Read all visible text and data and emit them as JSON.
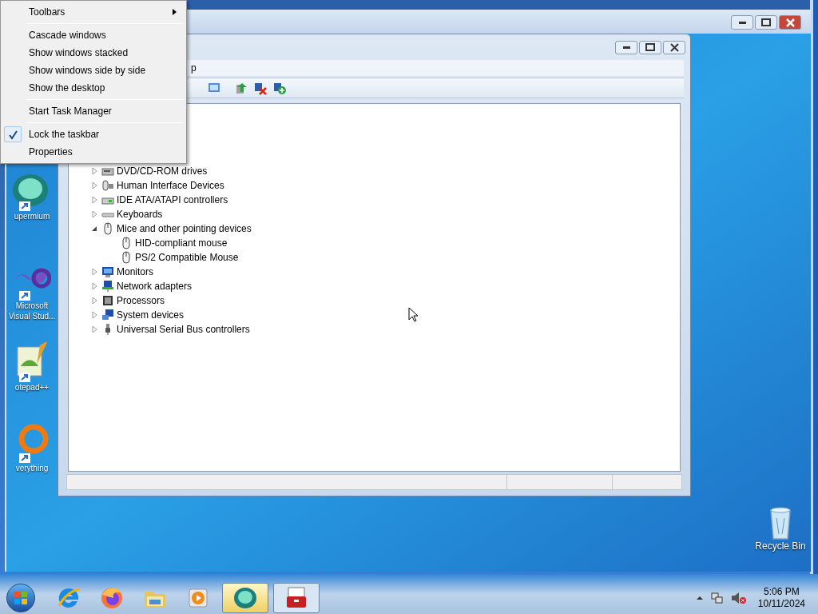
{
  "desktop_icons": [
    {
      "label": "upermium"
    },
    {
      "label": "Microsoft Visual Stud..."
    },
    {
      "label": "otepad++"
    },
    {
      "label": "verything"
    }
  ],
  "recycle_bin": {
    "label": "Recycle Bin"
  },
  "device_manager": {
    "menu_fragment": "p",
    "tree": [
      {
        "label": "DVD/CD-ROM drives",
        "expanded": false
      },
      {
        "label": "Human Interface Devices",
        "expanded": false
      },
      {
        "label": "IDE ATA/ATAPI controllers",
        "expanded": false
      },
      {
        "label": "Keyboards",
        "expanded": false
      },
      {
        "label": "Mice and other pointing devices",
        "expanded": true,
        "children": [
          {
            "label": "HID-compliant mouse"
          },
          {
            "label": "PS/2 Compatible Mouse"
          }
        ]
      },
      {
        "label": "Monitors",
        "expanded": false
      },
      {
        "label": "Network adapters",
        "expanded": false
      },
      {
        "label": "Processors",
        "expanded": false
      },
      {
        "label": "System devices",
        "expanded": false
      },
      {
        "label": "Universal Serial Bus controllers",
        "expanded": false
      }
    ]
  },
  "context_menu": {
    "items": [
      {
        "kind": "submenu",
        "label": "Toolbars"
      },
      {
        "kind": "separator"
      },
      {
        "kind": "item",
        "label": "Cascade windows"
      },
      {
        "kind": "item",
        "label": "Show windows stacked"
      },
      {
        "kind": "item",
        "label": "Show windows side by side"
      },
      {
        "kind": "item",
        "label": "Show the desktop"
      },
      {
        "kind": "separator"
      },
      {
        "kind": "item",
        "label": "Start Task Manager"
      },
      {
        "kind": "separator"
      },
      {
        "kind": "check",
        "label": "Lock the taskbar",
        "checked": true
      },
      {
        "kind": "item",
        "label": "Properties"
      }
    ]
  },
  "taskbar": {
    "apps": [
      {
        "running": false,
        "selected": false
      },
      {
        "running": false,
        "selected": false
      },
      {
        "running": false,
        "selected": false
      },
      {
        "running": false,
        "selected": false
      },
      {
        "running": true,
        "selected": true
      },
      {
        "running": true,
        "selected": false
      }
    ],
    "clock": {
      "time": "5:06 PM",
      "date": "10/11/2024"
    }
  }
}
